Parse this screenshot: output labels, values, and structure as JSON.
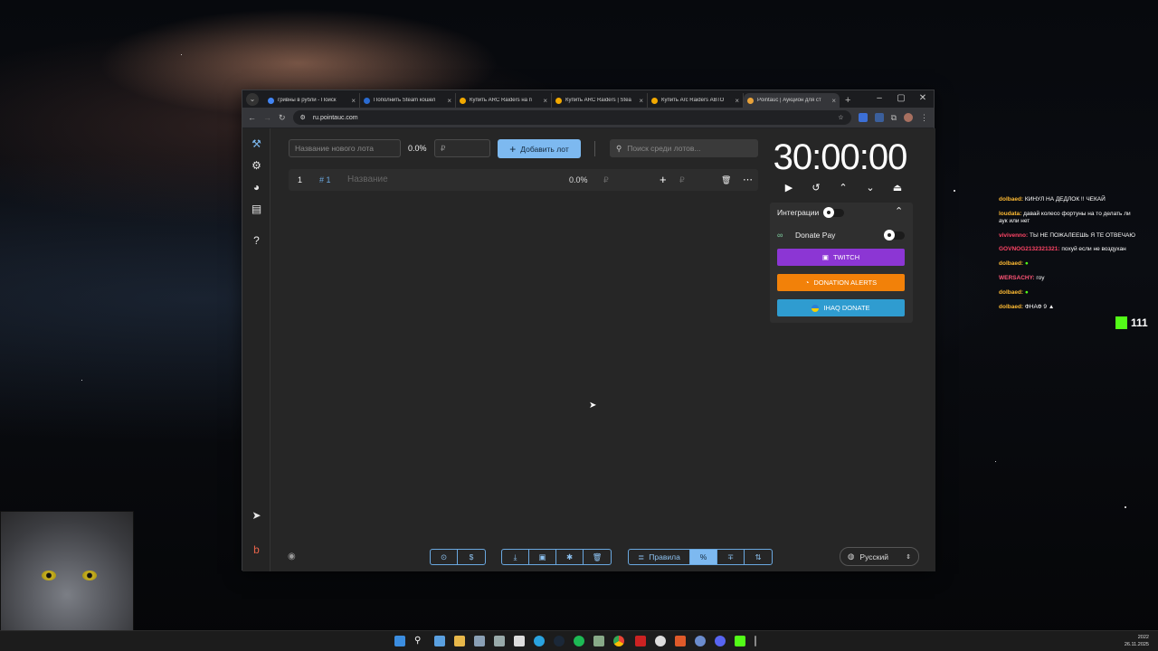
{
  "browser": {
    "tabs": [
      {
        "title": "гривны в рубли - Поиск",
        "color": "#4285f4"
      },
      {
        "title": "Пополнить Steam кошел",
        "color": "#2a6bd1"
      },
      {
        "title": "Купить ARC Raiders на п",
        "color": "#f2a900"
      },
      {
        "title": "Купить ARC Raiders | Stea",
        "color": "#f2a900"
      },
      {
        "title": "Купить Arc Raiders АВТО",
        "color": "#f2a900"
      },
      {
        "title": "Pointauc | Аукцион для ст",
        "color": "#e8a23a"
      }
    ],
    "url": "ru.pointauc.com"
  },
  "app": {
    "lot_name_placeholder": "Название нового лота",
    "percent": "0.0%",
    "amount_placeholder": "₽",
    "add_button": "Добавить лот",
    "search_placeholder": "Поиск среди лотов...",
    "lot": {
      "index": "1",
      "tag": "# 1",
      "name_placeholder": "Название",
      "percent": "0.0%",
      "currency": "₽"
    },
    "timer": "30:00:00",
    "integrations": {
      "title": "Интеграции",
      "donate_pay": "Donate Pay",
      "twitch": "TWITCH",
      "donation_alerts": "DONATION ALERTS",
      "ihaq": "IHAQ DONATE",
      "colors": {
        "twitch": "#8c36d4",
        "donation_alerts": "#f28109",
        "ihaq": "#2f9cd0"
      }
    },
    "bottom": {
      "rules": "Правила",
      "percent_icon": "%"
    },
    "language": "Русский"
  },
  "chat": {
    "messages": [
      {
        "user": "dolbaed:",
        "text": "КИНУЛ НА ДЕДЛОК !! ЧЕКАЙ",
        "color": "#ffbb33"
      },
      {
        "user": "loudata:",
        "text": "давай колесо фортуны на то делать ли",
        "color": "#ffbb33"
      },
      {
        "user": "",
        "text": "аук или нет",
        "color": "#ffbb33"
      },
      {
        "user": "vivivenno:",
        "text": "ТЫ НЕ ПОЖАЛЕЕШЬ Я ТЕ ОТВЕЧАЮ",
        "color": "#ff4466"
      },
      {
        "user": "GOVNOG2132321321:",
        "text": "похуй если не воздухан",
        "color": "#ff4466"
      },
      {
        "user": "dolbaed:",
        "text": "●",
        "color": "#ffbb33"
      },
      {
        "user": "WERSACHY:",
        "text": "гоу",
        "color": "#ff5577"
      },
      {
        "user": "dolbaed:",
        "text": "●",
        "color": "#ffbb33"
      },
      {
        "user": "dolbaed:",
        "text": "ФНАФ 9 ▲",
        "color": "#ffbb33"
      }
    ],
    "viewers": "111"
  },
  "taskbar": {
    "time": "2022",
    "date": "26.11.2025"
  }
}
